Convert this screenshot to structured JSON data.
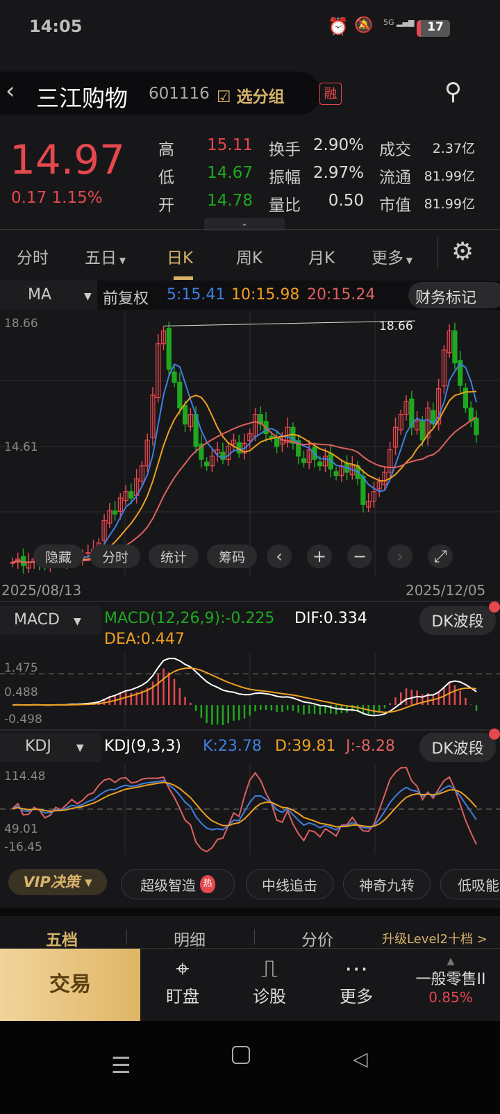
{
  "status_bar": {
    "time": "14:05",
    "battery": "17",
    "network": "5G",
    "icons": [
      "alarm-icon",
      "mute-icon",
      "signal-icon",
      "battery-icon"
    ]
  },
  "header": {
    "name": "三江购物",
    "code": "601116",
    "group_label": "选分组",
    "margin_badge": "融"
  },
  "quote": {
    "price": "14.97",
    "change": "0.17",
    "change_pct": "1.15%",
    "stats": [
      {
        "label": "高",
        "value": "15.11",
        "color": "red"
      },
      {
        "label": "低",
        "value": "14.67",
        "color": "green"
      },
      {
        "label": "开",
        "value": "14.78",
        "color": "green"
      }
    ],
    "stats2": [
      {
        "label": "换手",
        "value": "2.90%"
      },
      {
        "label": "振幅",
        "value": "2.97%"
      },
      {
        "label": "量比",
        "value": "0.50"
      }
    ],
    "stats3": [
      {
        "label": "成交",
        "value": "2.37亿"
      },
      {
        "label": "流通",
        "value": "81.99亿"
      },
      {
        "label": "市值",
        "value": "81.99亿"
      }
    ]
  },
  "period_tabs": [
    {
      "label": "分时"
    },
    {
      "label": "五日",
      "dropdown": true
    },
    {
      "label": "日K",
      "active": true
    },
    {
      "label": "周K"
    },
    {
      "label": "月K"
    },
    {
      "label": "更多",
      "dropdown": true
    }
  ],
  "ma_row": {
    "indicator": "MA",
    "adjust": "前复权",
    "ma5": "5:15.41",
    "ma10": "10:15.98",
    "ma20": "20:15.24",
    "finance_mark": "财务标记"
  },
  "kline": {
    "ymax_label": "18.66",
    "ymid_label": "14.61",
    "peak_label": "18.66",
    "ylim": [
      10.56,
      18.66
    ],
    "start_date": "2025/08/13",
    "end_date": "2025/12/05",
    "closes": [
      11.0,
      11.1,
      10.9,
      11.0,
      11.1,
      11.0,
      10.9,
      11.0,
      11.1,
      11.0,
      11.1,
      11.2,
      11.1,
      11.2,
      11.3,
      11.4,
      11.6,
      12.3,
      12.6,
      12.5,
      13.0,
      13.2,
      13.0,
      13.6,
      14.0,
      14.8,
      16.2,
      17.8,
      18.2,
      17.0,
      16.6,
      15.8,
      15.3,
      15.6,
      14.6,
      14.2,
      14.0,
      14.3,
      14.5,
      14.2,
      14.6,
      14.8,
      14.4,
      14.7,
      15.0,
      15.6,
      15.3,
      15.0,
      14.9,
      14.6,
      14.8,
      15.2,
      14.7,
      14.3,
      14.1,
      14.5,
      14.2,
      14.0,
      14.3,
      13.9,
      13.7,
      14.0,
      13.8,
      14.0,
      13.6,
      12.8,
      12.9,
      13.2,
      13.5,
      13.8,
      14.5,
      15.2,
      15.6,
      16.0,
      15.2,
      15.4,
      14.8,
      15.8,
      15.3,
      16.4,
      17.6,
      18.2,
      17.2,
      16.5,
      15.8,
      15.4,
      14.97
    ],
    "overlay_buttons": [
      "隐藏",
      "分时",
      "统计",
      "筹码"
    ],
    "overlay_icons": [
      "chevron-left-icon",
      "zoom-in-icon",
      "zoom-out-icon",
      "chevron-right-icon",
      "fullscreen-icon"
    ]
  },
  "macd": {
    "indicator": "MACD",
    "title": "MACD(12,26,9):-0.225",
    "dif": "DIF:0.334",
    "dea": "DEA:0.447",
    "ticks": [
      "1.475",
      "0.488",
      "-0.498"
    ],
    "dk_label": "DK波段"
  },
  "kdj": {
    "indicator": "KDJ",
    "title": "KDJ(9,3,3)",
    "k": "K:23.78",
    "d": "D:39.81",
    "j": "J:-8.28",
    "ticks": [
      "114.48",
      "49.01",
      "-16.45"
    ],
    "dk_label": "DK波段"
  },
  "strategies": {
    "vip": "VIP决策",
    "chips": [
      "超级智造",
      "中线追击",
      "神奇九转",
      "低吸能"
    ],
    "hot_badge": "热"
  },
  "bottom_tabs": [
    "五档",
    "明细",
    "分价"
  ],
  "upgrade": "升级Level2十档 >",
  "bottom_bar": {
    "trade": "交易",
    "buttons": [
      "盯盘",
      "诊股",
      "更多"
    ],
    "sector": "一般零售II",
    "sector_pct": "0.85%"
  },
  "colors": {
    "up": "#e5484d",
    "down": "#1fa81f",
    "ma5": "#3f7fe0",
    "ma10": "#f0a020",
    "ma20": "#e06060",
    "gold": "#d8b36a"
  }
}
